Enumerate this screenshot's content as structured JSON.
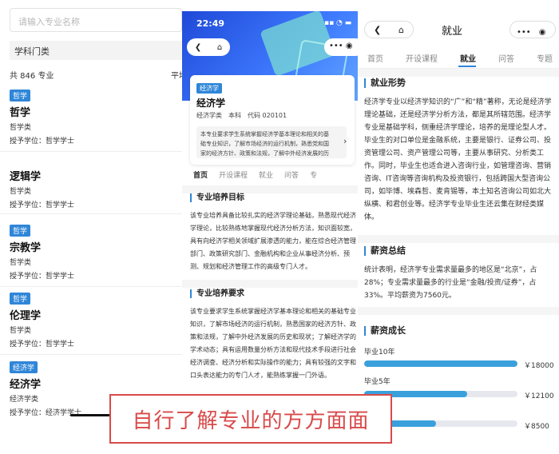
{
  "list": {
    "search_placeholder": "请输入专业名称",
    "category_filter": "学科门类",
    "count": "共 846 专业",
    "count_right": "平均",
    "items": [
      {
        "tag": "哲学",
        "name": "哲学",
        "sub": "哲学类",
        "degree": "授予学位：哲学学士"
      },
      {
        "tag": "",
        "name": "逻辑学",
        "sub": "哲学类",
        "degree": "授予学位：哲学学士"
      },
      {
        "tag": "哲学",
        "name": "宗教学",
        "sub": "哲学类",
        "degree": "授予学位：哲学学士"
      },
      {
        "tag": "哲学",
        "name": "伦理学",
        "sub": "哲学类",
        "degree": "授予学位：哲学学士"
      },
      {
        "tag": "经济学",
        "name": "经济学",
        "sub": "经济学类",
        "degree": "授予学位：经济学学士"
      }
    ]
  },
  "detail": {
    "time": "22:49",
    "status_icons": "▪▪ ◔ ▬",
    "card": {
      "tag": "经济学",
      "name": "经济学",
      "meta": "经济学类　本科　代码 020101",
      "desc": "本专业要求学生系统掌握经济学基本理论和相关的基础专业知识，了解市场经济的运行机制，熟悉党和国家的经济方针、政策和法规，了解中外经济发展的历"
    },
    "tabs": [
      "首页",
      "开设课程",
      "就业",
      "问答",
      "专"
    ],
    "goal_title": "专业培养目标",
    "goal_body": "该专业培养具备比较扎实的经济学理论基础，熟悉现代经济学理论，比较熟练地掌握现代经济分析方法，知识面较宽，具有向经济学相关领域扩展渗透的能力，能在综合经济管理部门、政策研究部门、金融机构和企业从事经济分析、预测、规划和经济管理工作的高级专门人才。",
    "req_title": "专业培养要求",
    "req_body": "该专业要求学生系统掌握经济学基本理论和相关的基础专业知识，了解市场经济的运行机制，熟悉国家的经济方针、政策和法规，了解中外经济发展的历史和现状；了解经济学的学术动态；具有运用数量分析方法和现代技术手段进行社会经济调查、经济分析和实际操作的能力；具有较强的文字和口头表达能力的专门人才，能熟练掌握一门外语。"
  },
  "employment": {
    "title": "就业",
    "tabs": [
      "首页",
      "开设课程",
      "就业",
      "问答",
      "专题"
    ],
    "active_tab": "就业",
    "situation_title": "就业形势",
    "situation_body": "经济学专业以经济学知识的“广”和“精”著称，无论是经济学理论基础，还是经济学分析方法，都是其所辖范围。经济学专业是基础学科，侧重经济学理论，培养的是理论型人才。毕业生的对口单位是金融系统，主要是银行、证券公司、投资管理公司、资产管理公司等，主要从事研究、分析类工作。同时，毕业生也适合进入咨询行业，如管理咨询、营销咨询、IT咨询等咨询机构及投资银行，包括跨国大型咨询公司，如毕博、埃森哲、麦肯锡等，本土知名咨询公司如北大纵横、和君创业等。经济学专业毕业生还云集在财经类媒体。",
    "salary_title": "薪资总结",
    "salary_body": "统计表明，经济学专业需求量最多的地区是“北京”，占28%；专业需求量最多的行业是“金融/投资/证券”，占33%。平均薪资为7560元。",
    "growth_title": "薪资成长",
    "growth": [
      {
        "label": "毕业10年",
        "value": "￥18000",
        "fill": 1.0
      },
      {
        "label": "毕业5年",
        "value": "￥12100",
        "fill": 0.67
      },
      {
        "label": "",
        "value": "￥8500",
        "fill": 0.47
      }
    ]
  },
  "caption": "自行了解专业的方方面面",
  "colors": {
    "accent": "#2f86d8",
    "caption": "#d94a4a",
    "bar": "#3aa0dc"
  }
}
